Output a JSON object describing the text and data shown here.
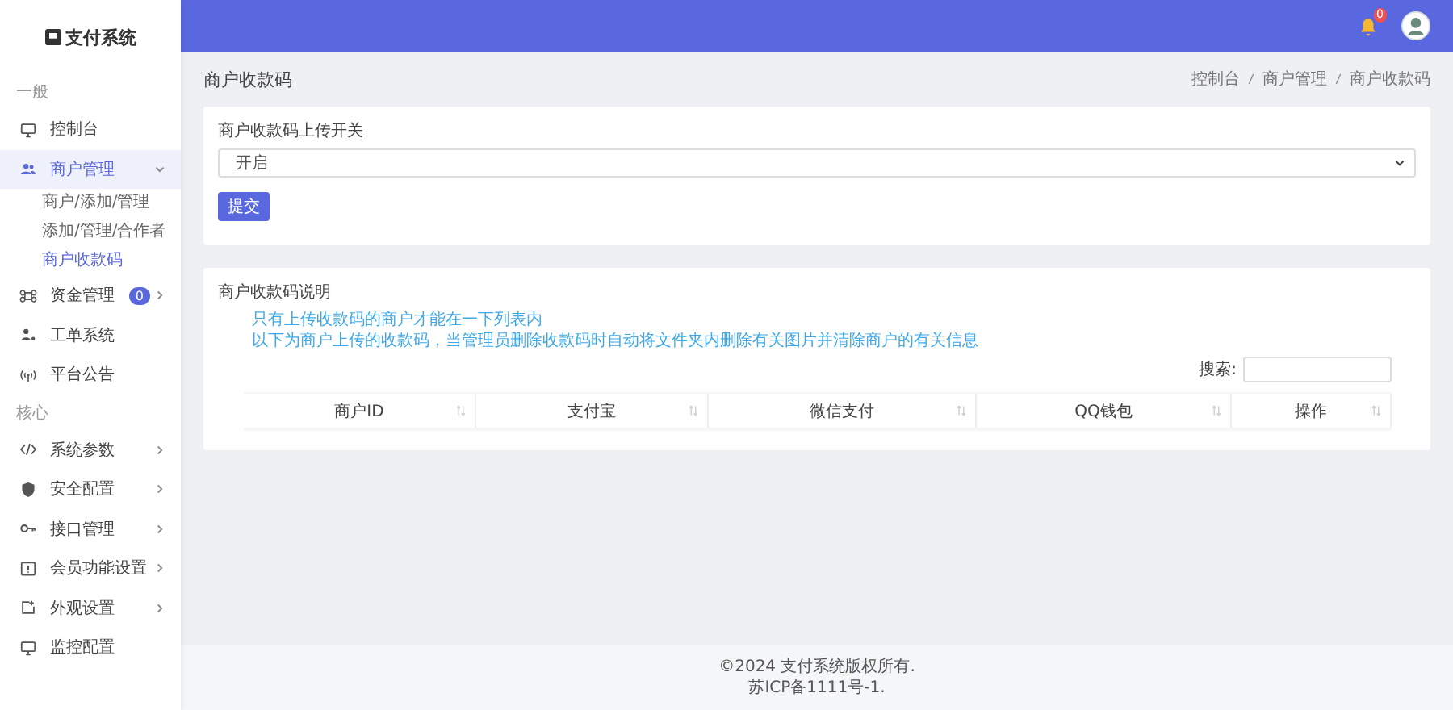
{
  "sidebar": {
    "logo": "支付系统",
    "sections": [
      {
        "heading": "一般",
        "items": [
          {
            "label": "控制台",
            "selected": false
          },
          {
            "label": "商户管理",
            "selected": true,
            "expanded": true,
            "children": [
              {
                "label": "商户/添加/管理",
                "selected": false
              },
              {
                "label": "添加/管理/合作者",
                "selected": false
              },
              {
                "label": "商户收款码",
                "selected": true
              }
            ]
          },
          {
            "label": "资金管理",
            "selected": false,
            "expanded": false,
            "badge": "0"
          },
          {
            "label": "工单系统",
            "selected": false
          },
          {
            "label": "平台公告",
            "selected": false
          }
        ]
      },
      {
        "heading": "核心",
        "items": [
          {
            "label": "系统参数",
            "selected": false,
            "expanded": false
          },
          {
            "label": "安全配置",
            "selected": false,
            "expanded": false
          },
          {
            "label": "接口管理",
            "selected": false,
            "expanded": false
          },
          {
            "label": "会员功能设置",
            "selected": false,
            "expanded": false
          },
          {
            "label": "外观设置",
            "selected": false,
            "expanded": false
          },
          {
            "label": "监控配置",
            "selected": false
          }
        ]
      }
    ]
  },
  "topbar": {
    "notification_badge": "0"
  },
  "page": {
    "title": "商户收款码",
    "breadcrumb": [
      "控制台",
      "商户管理",
      "商户收款码"
    ]
  },
  "form_card": {
    "label": "商户收款码上传开关",
    "select_value": "开启",
    "submit": "提交"
  },
  "info_card": {
    "title": "商户收款码说明",
    "notes": [
      "只有上传收款码的商户才能在一下列表内",
      "以下为商户上传的收款码，当管理员删除收款码时自动将文件夹内删除有关图片并清除商户的有关信息"
    ],
    "search_label": "搜索:",
    "table": {
      "columns": [
        "商户ID",
        "支付宝",
        "微信支付",
        "QQ钱包",
        "操作"
      ]
    }
  },
  "footer": {
    "lines": [
      "©2024 支付系统版权所有.",
      "苏ICP备1111号-1."
    ]
  }
}
